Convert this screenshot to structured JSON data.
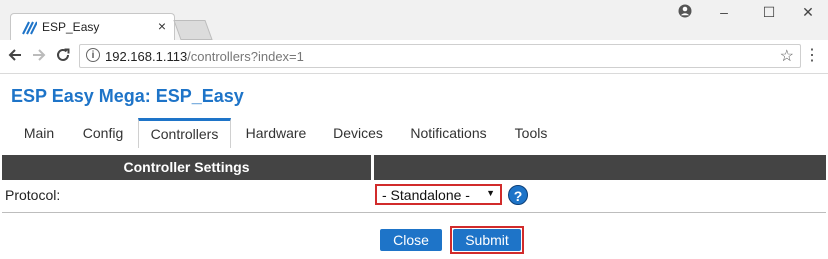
{
  "browser": {
    "tab_title": "ESP_Easy",
    "tab_close": "×",
    "url_host": "192.168.1.113",
    "url_path": "/controllers?index=1",
    "window_controls": {
      "profile": "●",
      "minimize": "–",
      "maximize": "☐",
      "close": "✕"
    }
  },
  "page": {
    "title": "ESP Easy Mega: ESP_Easy",
    "nav_tabs": [
      "Main",
      "Config",
      "Controllers",
      "Hardware",
      "Devices",
      "Notifications",
      "Tools"
    ],
    "active_tab": "Controllers",
    "settings_header": "Controller Settings",
    "protocol_label": "Protocol:",
    "protocol_value": "- Standalone -",
    "help_label": "?",
    "close_label": "Close",
    "submit_label": "Submit"
  },
  "colors": {
    "accent": "#1e74c8",
    "header_bg": "#444444",
    "highlight": "#d12b2b"
  }
}
